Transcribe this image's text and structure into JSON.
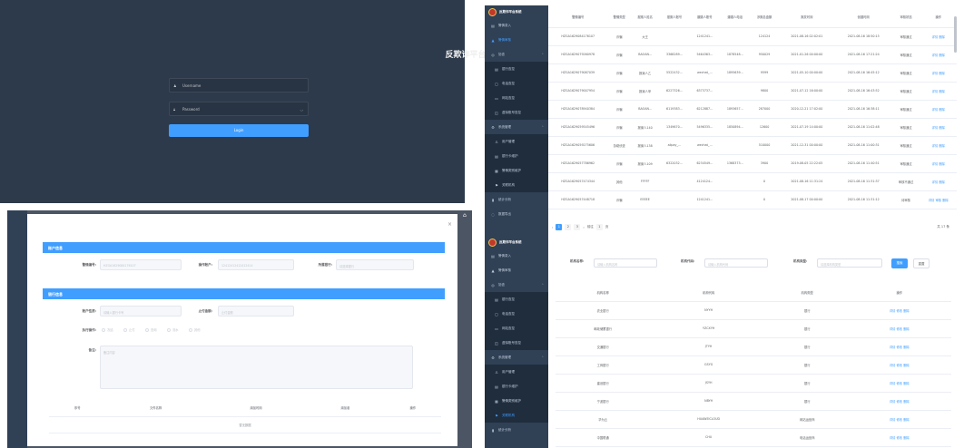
{
  "login": {
    "title": "反欺诈平台系统登录",
    "username_placeholder": "Username",
    "password_placeholder": "Password",
    "button": "Login"
  },
  "sidebar": {
    "logo": "反欺诈平台系统",
    "items": [
      {
        "icon": "▤",
        "label": "警情录入",
        "type": "item"
      },
      {
        "icon": "▲",
        "label": "警情审核",
        "type": "item",
        "active": true
      },
      {
        "icon": "◎",
        "label": "协查",
        "type": "group"
      },
      {
        "icon": "▤",
        "label": "银行查控",
        "type": "sub"
      },
      {
        "icon": "▢",
        "label": "电话查控",
        "type": "sub"
      },
      {
        "icon": "▭",
        "label": "网站查控",
        "type": "sub"
      },
      {
        "icon": "◫",
        "label": "虚拟账号查控",
        "type": "sub"
      },
      {
        "icon": "⚙",
        "label": "系统管理",
        "type": "group"
      },
      {
        "icon": "♙",
        "label": "用户管理",
        "type": "sub"
      },
      {
        "icon": "▤",
        "label": "银行卡维护",
        "type": "sub"
      },
      {
        "icon": "▦",
        "label": "警情类别维护",
        "type": "sub"
      },
      {
        "icon": "⚑",
        "label": "关联机构",
        "type": "sub"
      },
      {
        "icon": "▮",
        "label": "统计分析",
        "type": "item"
      },
      {
        "icon": "◌",
        "label": "数据导出",
        "type": "item"
      }
    ]
  },
  "sidebar2": {
    "logo": "反欺诈平台系统",
    "items": [
      {
        "icon": "▤",
        "label": "警情录入",
        "type": "item"
      },
      {
        "icon": "▲",
        "label": "警情审核",
        "type": "item"
      },
      {
        "icon": "◎",
        "label": "协查",
        "type": "group"
      },
      {
        "icon": "▤",
        "label": "银行查控",
        "type": "sub"
      },
      {
        "icon": "▢",
        "label": "电话查控",
        "type": "sub"
      },
      {
        "icon": "▭",
        "label": "网站查控",
        "type": "sub"
      },
      {
        "icon": "◫",
        "label": "虚拟账号查控",
        "type": "sub"
      },
      {
        "icon": "⚙",
        "label": "系统管理",
        "type": "group"
      },
      {
        "icon": "♙",
        "label": "用户管理",
        "type": "sub"
      },
      {
        "icon": "▤",
        "label": "银行卡维护",
        "type": "sub"
      },
      {
        "icon": "▦",
        "label": "警情类别维护",
        "type": "sub"
      },
      {
        "icon": "⚑",
        "label": "关联机构",
        "type": "sub",
        "active": true
      },
      {
        "icon": "▮",
        "label": "统计分析",
        "type": "item"
      }
    ]
  },
  "alerts": {
    "headers": [
      "警情编号",
      "警情类型",
      "报案人姓名",
      "报案人账号",
      "嫌疑人账号",
      "嫌疑人电话",
      "涉案总金额",
      "案发时间",
      "创建时间",
      "审核状态",
      "操作"
    ],
    "rows": [
      [
        "HZGA1629084176107",
        "诈骗",
        "大王",
        "",
        "1241241...",
        "",
        "124124",
        "2021-08-16 02:02:01",
        "2021-08-16 18:50:15",
        "审核通过",
        "详情 删除"
      ],
      [
        "HZGA1629079260978",
        "诈骗",
        "BAOAN...",
        "3368289...",
        "5464363...",
        "1878548...",
        "950029",
        "2021-01-26 00:00:00",
        "2021-08-16 17:21:24",
        "审核通过",
        "详情 删除"
      ],
      [
        "HZGA1629079087039",
        "诈骗",
        "报案人乙",
        "5522432...",
        "wechat_...",
        "1895639...",
        "9599",
        "2021-05-10 00:00:00",
        "2021-08-16 16:45:12",
        "审核通过",
        "详情 删除"
      ],
      [
        "HZGA1629079007954",
        "诈骗",
        "报案人甲",
        "6227326...",
        "6373737...",
        "",
        "9800",
        "2021-07-12 16:00:00",
        "2021-08-16 16:43:52",
        "审核通过",
        "详情 删除"
      ],
      [
        "HZGA1629078940384",
        "诈骗",
        "BAOAN...",
        "6119383...",
        "6212887...",
        "1893657...",
        "287000",
        "2020-12-21 17:02:00",
        "2021-08-16 16:38:11",
        "审核通过",
        "详情 删除"
      ],
      [
        "HZGA1629059545496",
        "诈骗",
        "报案人140",
        "1349670...",
        "5496335...",
        "1850894...",
        "12600",
        "2021-07-19 14:00:00",
        "2021-08-16 11:02:48",
        "审核通过",
        "详情 删除"
      ],
      [
        "HZGA1629059275606",
        "协助侦查",
        "报案人138",
        "alipay_...",
        "wechat_...",
        "",
        "510000",
        "2021-12-31 00:00:00",
        "2021-08-16 11:00:31",
        "审核通过",
        "详情 删除"
      ],
      [
        "HZGA1629057786962",
        "诈骗",
        "报案人109",
        "6322032...",
        "6234549...",
        "1368373...",
        "3900",
        "2019-08-05 22:22:05",
        "2021-08-16 11:40:51",
        "审核通过",
        "详情 删除"
      ],
      [
        "HZGA1629057474344",
        "其他",
        "FFFFF",
        "",
        "4124124...",
        "",
        "0",
        "2021-08-16 11:31:24",
        "2021-08-16 11:31:37",
        "审核不通过",
        "详情 删除"
      ],
      [
        "HZGA1629057448718",
        "诈骗",
        "EEEEE",
        "",
        "1241241...",
        "",
        "0",
        "2021-08-17 00:00:00",
        "2021-08-16 11:31:12",
        "待审核",
        "详情 审核 删除"
      ]
    ],
    "pagination": {
      "pages": [
        "1",
        "2",
        "3"
      ],
      "per_page": "前往",
      "goto": "1",
      "goto_unit": "页",
      "total": "共 17 条"
    }
  },
  "orgs": {
    "filters": {
      "name_label": "机构名称:",
      "name_placeholder": "请输入机构名称",
      "code_label": "机构代码:",
      "code_placeholder": "请输入机构代码",
      "type_label": "机构类型:",
      "type_placeholder": "请选择机构类型",
      "search": "搜索",
      "reset": "重置"
    },
    "headers": [
      "机构名称",
      "机构代码",
      "机构类型",
      "操作"
    ],
    "rows": [
      [
        "农业银行",
        "NYYH",
        "银行",
        "详情 修改 删除"
      ],
      [
        "邮政储蓄银行",
        "YZCXYH",
        "银行",
        "详情 修改 删除"
      ],
      [
        "交通银行",
        "JTYH",
        "银行",
        "详情 修改 删除"
      ],
      [
        "工商银行",
        "GSYG",
        "银行",
        "详情 修改 删除"
      ],
      [
        "建设银行",
        "JSYH",
        "银行",
        "详情 修改 删除"
      ],
      [
        "宁波银行",
        "NBYH",
        "银行",
        "详情 修改 删除"
      ],
      [
        "华为云",
        "HUAWEICLOUD",
        "网站运营商",
        "详情 修改 删除"
      ],
      [
        "中国联通",
        "CHU",
        "电话运营商",
        "详情 修改 删除"
      ]
    ]
  },
  "modal": {
    "close": "×",
    "sec1": "账户信息",
    "f_case": "警情编号:",
    "v_case": "HZGA1629084176107",
    "f_acct": "操作账户:",
    "v_acct": "12412412412412414",
    "f_bank": "所属银行:",
    "v_bank": "请选择银行",
    "sec2": "银行信息",
    "f_type": "账户性质:",
    "v_type": "请输入银行卡号",
    "f_amount": "止付金额:",
    "v_amount": "止付金额",
    "f_op": "执行操作:",
    "ops": [
      "冻结",
      "止付",
      "查询",
      "流水",
      "其他"
    ],
    "f_note": "备注:",
    "v_note": "备注内容",
    "file_headers": [
      "序号",
      "文件名称",
      "添加时间",
      "添加者",
      "操作"
    ],
    "empty": "暂无数据"
  },
  "bg_corner_icon": "app-icon"
}
